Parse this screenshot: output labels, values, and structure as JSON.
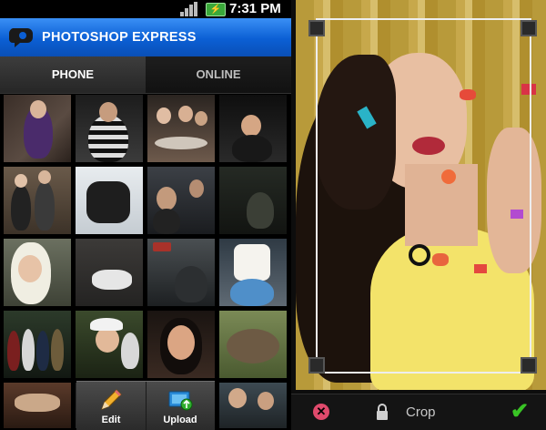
{
  "status_bar": {
    "time": "7:31 PM"
  },
  "app": {
    "title": "PHOTOSHOP EXPRESS"
  },
  "tabs": [
    {
      "label": "PHONE"
    },
    {
      "label": "ONLINE"
    }
  ],
  "gallery": {
    "thumbnail_count": 20
  },
  "toolbar": {
    "edit_label": "Edit",
    "upload_label": "Upload"
  },
  "crop": {
    "label": "Crop"
  },
  "colors": {
    "app_bar": "#0b5fd4",
    "cancel": "#e04a6c",
    "confirm": "#39c425",
    "crop_frame": "#eeeeee"
  },
  "icons": {
    "edit": "pencil-icon",
    "upload": "upload-icon",
    "cancel": "cancel-icon",
    "lock": "lock-icon",
    "confirm": "checkmark-icon"
  }
}
